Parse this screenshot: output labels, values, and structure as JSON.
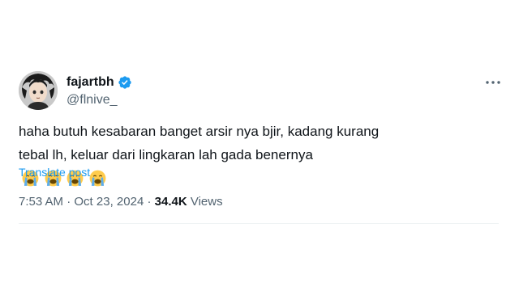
{
  "author": {
    "display_name": "fajartbh",
    "handle": "@flnive_",
    "verified": true,
    "verified_color": "#1d9bf0",
    "avatar_icon": "anime-character-avatar"
  },
  "tweet": {
    "text": "haha butuh kesabaran banget arsir nya bjir, kadang kurang tebal lh, keluar dari lingkaran lah gada benernya",
    "emoji": [
      "loudly-crying-face",
      "loudly-crying-face",
      "loudly-crying-face",
      "loudly-crying-face"
    ],
    "translate_label": "Translate post"
  },
  "meta": {
    "time": "7:53 AM",
    "separator": " · ",
    "date": "Oct 23, 2024",
    "views_count": "34.4K",
    "views_label": " Views"
  },
  "colors": {
    "text": "#0f1419",
    "secondary": "#536471",
    "link": "#1d9bf0",
    "divider": "#eff3f4"
  }
}
